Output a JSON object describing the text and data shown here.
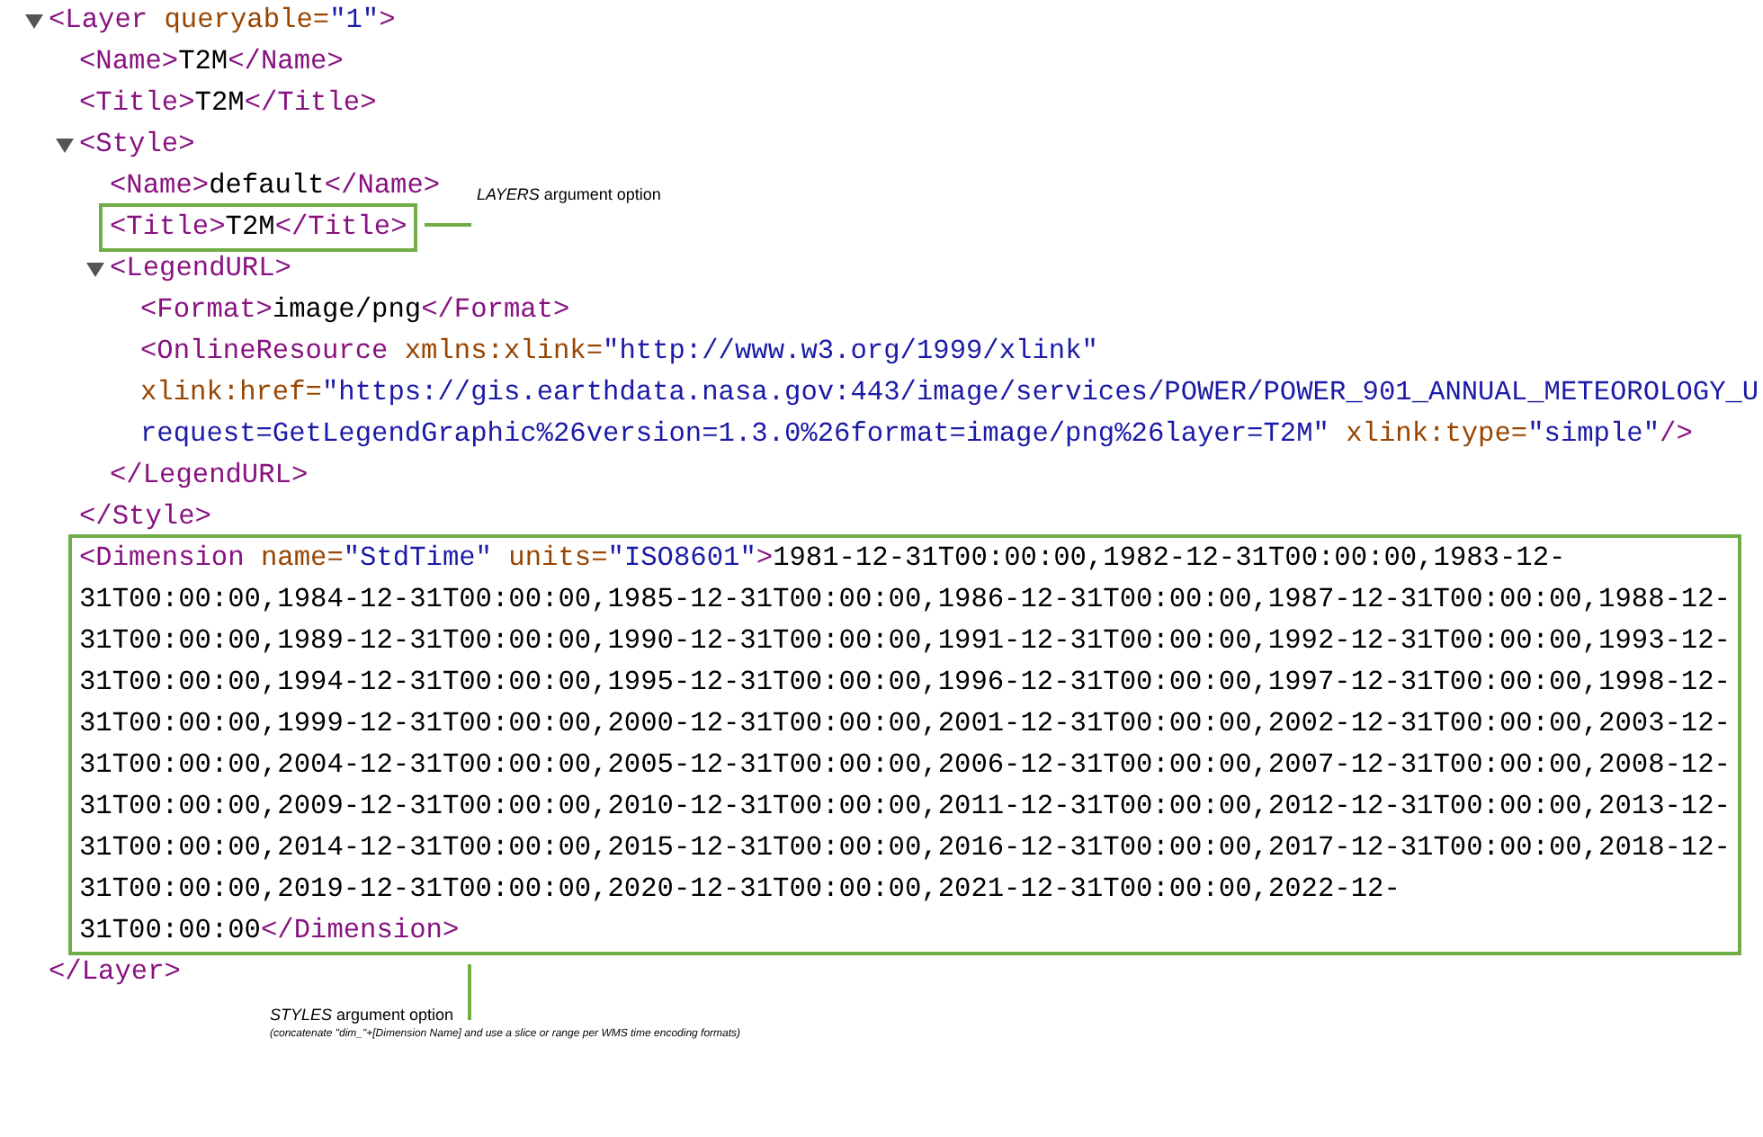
{
  "xml_tree": [
    {
      "kind": "element",
      "expanded": true,
      "open": [
        {
          "kind": "tag",
          "t": "<Layer"
        },
        {
          "kind": "attr",
          "t": " queryable="
        },
        {
          "kind": "value",
          "t": "\"1\""
        },
        {
          "kind": "tag",
          "t": ">"
        }
      ],
      "close": [
        {
          "kind": "tag",
          "t": "</Layer>"
        }
      ],
      "children": [
        {
          "kind": "leaf",
          "lines": [
            [
              {
                "kind": "tag",
                "t": "<Name>"
              },
              {
                "kind": "text",
                "t": "T2M"
              },
              {
                "kind": "tag",
                "t": "</Name>"
              }
            ]
          ]
        },
        {
          "kind": "leaf",
          "lines": [
            [
              {
                "kind": "tag",
                "t": "<Title>"
              },
              {
                "kind": "text",
                "t": "T2M"
              },
              {
                "kind": "tag",
                "t": "</Title>"
              }
            ]
          ]
        },
        {
          "kind": "element",
          "expanded": true,
          "open": [
            {
              "kind": "tag",
              "t": "<Style>"
            }
          ],
          "close": [
            {
              "kind": "tag",
              "t": "</Style>"
            }
          ],
          "children": [
            {
              "kind": "leaf",
              "lines": [
                [
                  {
                    "kind": "tag",
                    "t": "<Name>"
                  },
                  {
                    "kind": "text",
                    "t": "default"
                  },
                  {
                    "kind": "tag",
                    "t": "</Name>"
                  }
                ]
              ]
            },
            {
              "kind": "leaf",
              "highlighted": true,
              "lines": [
                [
                  {
                    "kind": "tag",
                    "t": "<Title>"
                  },
                  {
                    "kind": "text",
                    "t": "T2M"
                  },
                  {
                    "kind": "tag",
                    "t": "</Title>"
                  }
                ]
              ]
            },
            {
              "kind": "element",
              "expanded": true,
              "open": [
                {
                  "kind": "tag",
                  "t": "<LegendURL>"
                }
              ],
              "close": [
                {
                  "kind": "tag",
                  "t": "</LegendURL>"
                }
              ],
              "children": [
                {
                  "kind": "leaf",
                  "lines": [
                    [
                      {
                        "kind": "tag",
                        "t": "<Format>"
                      },
                      {
                        "kind": "text",
                        "t": "image/png"
                      },
                      {
                        "kind": "tag",
                        "t": "</Format>"
                      }
                    ]
                  ]
                },
                {
                  "kind": "leaf",
                  "lines": [
                    [
                      {
                        "kind": "tag",
                        "t": "<OnlineResource"
                      },
                      {
                        "kind": "attr",
                        "t": " xmlns:xlink="
                      },
                      {
                        "kind": "value",
                        "t": "\"http://www.w3.org/1999/xlink\""
                      }
                    ],
                    [
                      {
                        "kind": "attr",
                        "t": "xlink:href="
                      },
                      {
                        "kind": "value",
                        "t": "\"https://gis.earthdata.nasa.gov:443/image/services/POWER/POWER_901_ANNUAL_METEOROLOGY_U"
                      }
                    ],
                    [
                      {
                        "kind": "value",
                        "t": "request=GetLegendGraphic%26version=1.3.0%26format=image/png%26layer=T2M\""
                      },
                      {
                        "kind": "attr",
                        "t": " xlink:type="
                      },
                      {
                        "kind": "value",
                        "t": "\"simple\""
                      },
                      {
                        "kind": "tag",
                        "t": "/>"
                      }
                    ]
                  ]
                }
              ]
            }
          ]
        },
        {
          "kind": "leaf",
          "highlighted": true,
          "lines": [
            [
              {
                "kind": "tag",
                "t": "<Dimension"
              },
              {
                "kind": "attr",
                "t": " name="
              },
              {
                "kind": "value",
                "t": "\"StdTime\""
              },
              {
                "kind": "attr",
                "t": " units="
              },
              {
                "kind": "value",
                "t": "\"ISO8601\""
              },
              {
                "kind": "tag",
                "t": ">"
              },
              {
                "kind": "text",
                "t": "1981-12-31T00:00:00,1982-12-31T00:00:00,1983-12-"
              }
            ],
            [
              {
                "kind": "text",
                "t": "31T00:00:00,1984-12-31T00:00:00,1985-12-31T00:00:00,1986-12-31T00:00:00,1987-12-31T00:00:00,1988-12-"
              }
            ],
            [
              {
                "kind": "text",
                "t": "31T00:00:00,1989-12-31T00:00:00,1990-12-31T00:00:00,1991-12-31T00:00:00,1992-12-31T00:00:00,1993-12-"
              }
            ],
            [
              {
                "kind": "text",
                "t": "31T00:00:00,1994-12-31T00:00:00,1995-12-31T00:00:00,1996-12-31T00:00:00,1997-12-31T00:00:00,1998-12-"
              }
            ],
            [
              {
                "kind": "text",
                "t": "31T00:00:00,1999-12-31T00:00:00,2000-12-31T00:00:00,2001-12-31T00:00:00,2002-12-31T00:00:00,2003-12-"
              }
            ],
            [
              {
                "kind": "text",
                "t": "31T00:00:00,2004-12-31T00:00:00,2005-12-31T00:00:00,2006-12-31T00:00:00,2007-12-31T00:00:00,2008-12-"
              }
            ],
            [
              {
                "kind": "text",
                "t": "31T00:00:00,2009-12-31T00:00:00,2010-12-31T00:00:00,2011-12-31T00:00:00,2012-12-31T00:00:00,2013-12-"
              }
            ],
            [
              {
                "kind": "text",
                "t": "31T00:00:00,2014-12-31T00:00:00,2015-12-31T00:00:00,2016-12-31T00:00:00,2017-12-31T00:00:00,2018-12-"
              }
            ],
            [
              {
                "kind": "text",
                "t": "31T00:00:00,2019-12-31T00:00:00,2020-12-31T00:00:00,2021-12-31T00:00:00,2022-12-"
              }
            ],
            [
              {
                "kind": "text",
                "t": "31T00:00:00"
              },
              {
                "kind": "tag",
                "t": "</Dimension>"
              }
            ]
          ]
        }
      ]
    }
  ],
  "annotations": [
    {
      "kind": "layers",
      "label": "*LAYERS* argument option"
    },
    {
      "kind": "styles",
      "label": "*STYLES* argument option",
      "note": "(concatenate \"dim_\"+[Dimension Name] and use a slice or range per WMS time encoding formats)"
    }
  ]
}
